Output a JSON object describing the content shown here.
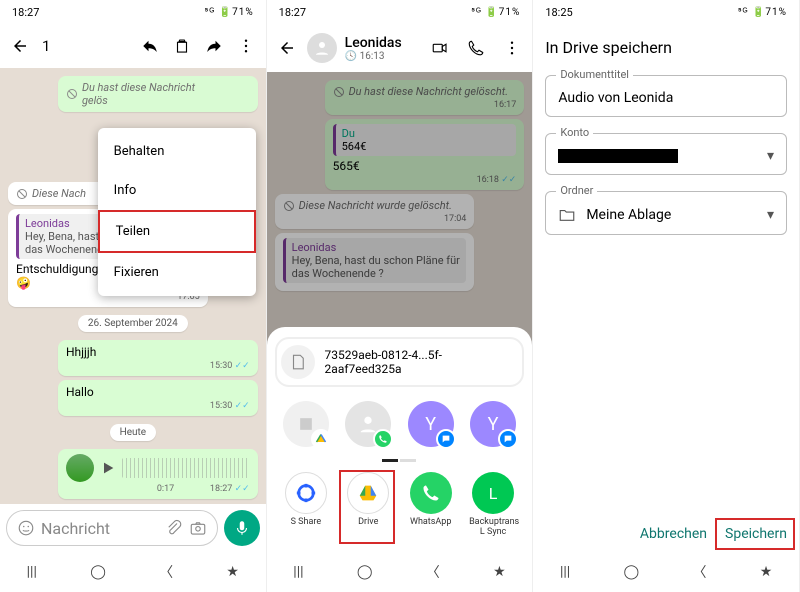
{
  "phone1": {
    "statusbar": {
      "time": "18:27",
      "right": "⁵ᴳ 🔋71%"
    },
    "header": {
      "count": "1"
    },
    "menu": {
      "items": [
        "Behalten",
        "Info",
        "Teilen",
        "Fixieren"
      ]
    },
    "deleted_out": "Du hast diese Nachricht gelöst... gelös",
    "deleted_in": "Diese Nach",
    "quote": {
      "name": "Leonidas",
      "text": "Hey, Bena, hast du schon Pläne für das Wochenende ?"
    },
    "reply": "Entschuldigung, falsch gesendet🤪",
    "reply_time": "17:05",
    "date": "26. September 2024",
    "msgs": [
      {
        "t": "Hhjjjh",
        "time": "15:30"
      },
      {
        "t": "Hallo",
        "time": "15:30"
      }
    ],
    "heute": "Heute",
    "voice": {
      "dur": "0:17",
      "time": "18:27"
    },
    "input_placeholder": "Nachricht"
  },
  "phone2": {
    "statusbar": {
      "time": "18:27",
      "right": "⁵ᴳ 🔋71%"
    },
    "contact": {
      "name": "Leonidas",
      "sub": "16:13"
    },
    "deleted_out": "Du hast diese Nachricht gelöscht.",
    "deleted_out_time": "16:17",
    "reply": {
      "quote": "Du",
      "quote_text": "564€",
      "text": "565€",
      "time": "16:18"
    },
    "deleted_in": "Diese Nachricht wurde gelöscht.",
    "deleted_in_time": "17:04",
    "quote2": {
      "name": "Leonidas",
      "text": "Hey, Bena, hast du schon Pläne für das Wochenende ?"
    },
    "file": "73529aeb-0812-4...5f-2aaf7eed325a",
    "apps": [
      {
        "name": "S Share"
      },
      {
        "name": "Drive"
      },
      {
        "name": "WhatsApp"
      },
      {
        "name": "Backuptrans L Sync"
      }
    ]
  },
  "phone3": {
    "statusbar": {
      "time": "18:25",
      "right": "⁵ᴳ 🔋71%"
    },
    "title": "In Drive speichern",
    "doc_label": "Dokumenttitel",
    "doc_value": "Audio von Leonida",
    "account_label": "Konto",
    "folder_label": "Ordner",
    "folder_value": "Meine Ablage",
    "cancel": "Abbrechen",
    "save": "Speichern"
  }
}
